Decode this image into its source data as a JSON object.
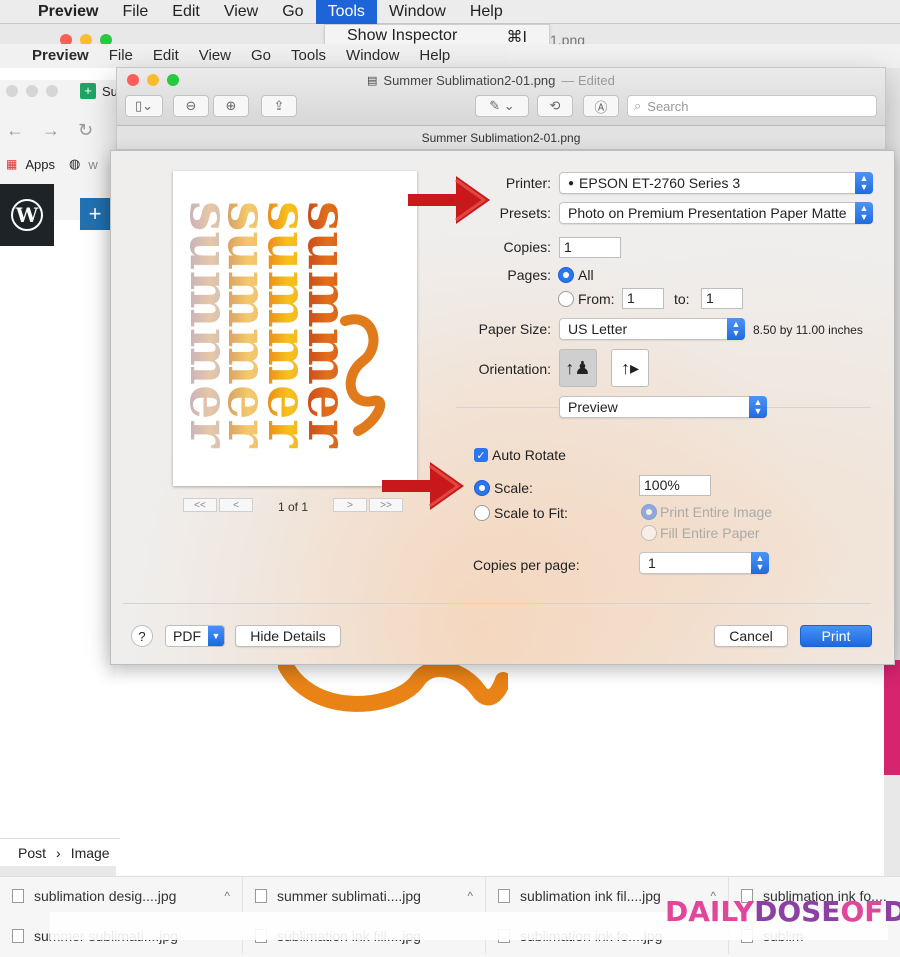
{
  "menubar": {
    "app": "Preview",
    "items": [
      "File",
      "Edit",
      "View",
      "Go",
      "Tools",
      "Window",
      "Help"
    ],
    "active": "Tools"
  },
  "tools_menu": {
    "item": "Show Inspector",
    "shortcut": "⌘I",
    "behind_text": "1.png"
  },
  "menubar2": {
    "app": "Preview",
    "items": [
      "File",
      "Edit",
      "View",
      "Go",
      "Tools",
      "Window",
      "Help"
    ]
  },
  "browser": {
    "bookmarks_label": "Apps",
    "tab_label": "Su",
    "tab_label2": "w"
  },
  "window": {
    "title": "Summer Sublimation2-01.png",
    "edited": "— Edited",
    "search_placeholder": "Search",
    "subtitle": "Summer Sublimation2-01.png"
  },
  "print": {
    "printer_label": "Printer:",
    "printer_value": "EPSON ET-2760 Series 3",
    "presets_label": "Presets:",
    "presets_value": "Photo on Premium Presentation Paper Matte",
    "copies_label": "Copies:",
    "copies_value": "1",
    "pages_label": "Pages:",
    "pages_all": "All",
    "pages_from": "From:",
    "from_value": "1",
    "to_label": "to:",
    "to_value": "1",
    "paper_size_label": "Paper Size:",
    "paper_size_value": "US Letter",
    "paper_dims": "8.50 by 11.00 inches",
    "orientation_label": "Orientation:",
    "section_value": "Preview",
    "auto_rotate": "Auto Rotate",
    "scale_label": "Scale:",
    "scale_value": "100%",
    "scale_to_fit": "Scale to Fit:",
    "print_entire": "Print Entire Image",
    "fill_entire": "Fill Entire Paper",
    "copies_per_page_label": "Copies per page:",
    "copies_per_page_value": "1",
    "page_indicator": "1 of 1",
    "nav_first": "<<",
    "nav_prev": "<",
    "nav_next": ">",
    "nav_last": ">>",
    "help": "?",
    "pdf": "PDF",
    "hide_details": "Hide Details",
    "cancel": "Cancel",
    "print": "Print"
  },
  "preview_words": [
    "summer",
    "summer",
    "summer",
    "summer"
  ],
  "breadcrumb": {
    "item1": "Post",
    "sep": "›",
    "item2": "Image"
  },
  "downloads": {
    "row1": [
      "sublimation desig....jpg",
      "summer sublimati....jpg",
      "sublimation ink fil....jpg",
      "sublimation ink fo...."
    ],
    "row2": [
      "summer sublimati....jpg",
      "sublimation ink fill....jpg",
      "sublimation ink fo....jpg",
      "sublim"
    ]
  },
  "brand": {
    "part1": "DAILY",
    "part2": "DOSE",
    "part3": "OF",
    "part4": "DIY"
  },
  "colors": {
    "accent": "#2b76ee",
    "arrow": "#c8181c",
    "brand_pink": "#e0479a",
    "brand_purple": "#8e3fa4"
  }
}
